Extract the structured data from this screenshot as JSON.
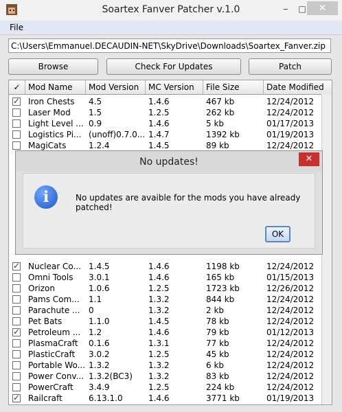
{
  "window": {
    "title": "Soartex Fanver Patcher v.1.0"
  },
  "menu": {
    "file": "File"
  },
  "path": "C:\\Users\\Emmanuel.DECAUDIN-NET\\SkyDrive\\Downloads\\Soartex_Fanver.zip",
  "buttons": {
    "browse": "Browse",
    "check": "Check For Updates",
    "patch": "Patch"
  },
  "table": {
    "headers": [
      "✓",
      "Mod Name",
      "Mod Version",
      "MC Version",
      "File Size",
      "Date Modified"
    ],
    "rows": [
      {
        "checked": true,
        "name": "Iron Chests",
        "mod": "4.5",
        "mc": "1.4.6",
        "size": "467 kb",
        "date": "12/24/2012"
      },
      {
        "checked": false,
        "name": "Laser Mod",
        "mod": "1.5",
        "mc": "1.2.5",
        "size": "262 kb",
        "date": "12/24/2012"
      },
      {
        "checked": false,
        "name": "Light Level ...",
        "mod": "0.9",
        "mc": "1.4.6",
        "size": "5 kb",
        "date": "01/17/2013"
      },
      {
        "checked": false,
        "name": "Logistics Pi...",
        "mod": "(unoff)0.7.0...",
        "mc": "1.4.7",
        "size": "1392 kb",
        "date": "01/19/2013"
      },
      {
        "checked": false,
        "name": "MagiCats",
        "mod": "1.2.4",
        "mc": "1.4.5",
        "size": "89 kb",
        "date": "12/24/2012"
      },
      {
        "checked": true,
        "name": "Nuclear Co...",
        "mod": "1.4.5",
        "mc": "1.4.6",
        "size": "1198 kb",
        "date": "12/24/2012"
      },
      {
        "checked": false,
        "name": "Omni Tools",
        "mod": "3.0.1",
        "mc": "1.4.6",
        "size": "165 kb",
        "date": "01/15/2013"
      },
      {
        "checked": false,
        "name": "Orizon",
        "mod": "1.0.6",
        "mc": "1.2.5",
        "size": "1723 kb",
        "date": "12/26/2012"
      },
      {
        "checked": false,
        "name": "Pams Com...",
        "mod": "1.1",
        "mc": "1.3.2",
        "size": "844 kb",
        "date": "12/24/2012"
      },
      {
        "checked": false,
        "name": "Parachute ...",
        "mod": "0",
        "mc": "1.3.2",
        "size": "2 kb",
        "date": "12/24/2012"
      },
      {
        "checked": false,
        "name": "Pet Bats",
        "mod": "1.1.0",
        "mc": "1.4.5",
        "size": "78 kb",
        "date": "12/24/2012"
      },
      {
        "checked": true,
        "name": "Petroleum ...",
        "mod": "1.2",
        "mc": "1.4.6",
        "size": "79 kb",
        "date": "01/12/2013"
      },
      {
        "checked": false,
        "name": "PlasmaCraft",
        "mod": "0.1.6",
        "mc": "1.3.1",
        "size": "77 kb",
        "date": "12/24/2012"
      },
      {
        "checked": false,
        "name": "PlasticCraft",
        "mod": "3.0.2",
        "mc": "1.2.5",
        "size": "45 kb",
        "date": "12/24/2012"
      },
      {
        "checked": false,
        "name": "Portable Wo...",
        "mod": "1.3.2",
        "mc": "1.3.2",
        "size": "6 kb",
        "date": "12/24/2012"
      },
      {
        "checked": false,
        "name": "Power Conv...",
        "mod": "1.3.2(BC3)",
        "mc": "1.3.2",
        "size": "83 kb",
        "date": "12/24/2012"
      },
      {
        "checked": false,
        "name": "PowerCraft",
        "mod": "3.4.9",
        "mc": "1.2.5",
        "size": "224 kb",
        "date": "12/24/2012"
      },
      {
        "checked": true,
        "name": "Railcraft",
        "mod": "6.13.1.0",
        "mc": "1.4.6",
        "size": "3771 kb",
        "date": "01/19/2013"
      }
    ]
  },
  "dialog": {
    "title": "No updates!",
    "message": "No updates are avaible for the mods you have already patched!",
    "ok": "OK"
  }
}
